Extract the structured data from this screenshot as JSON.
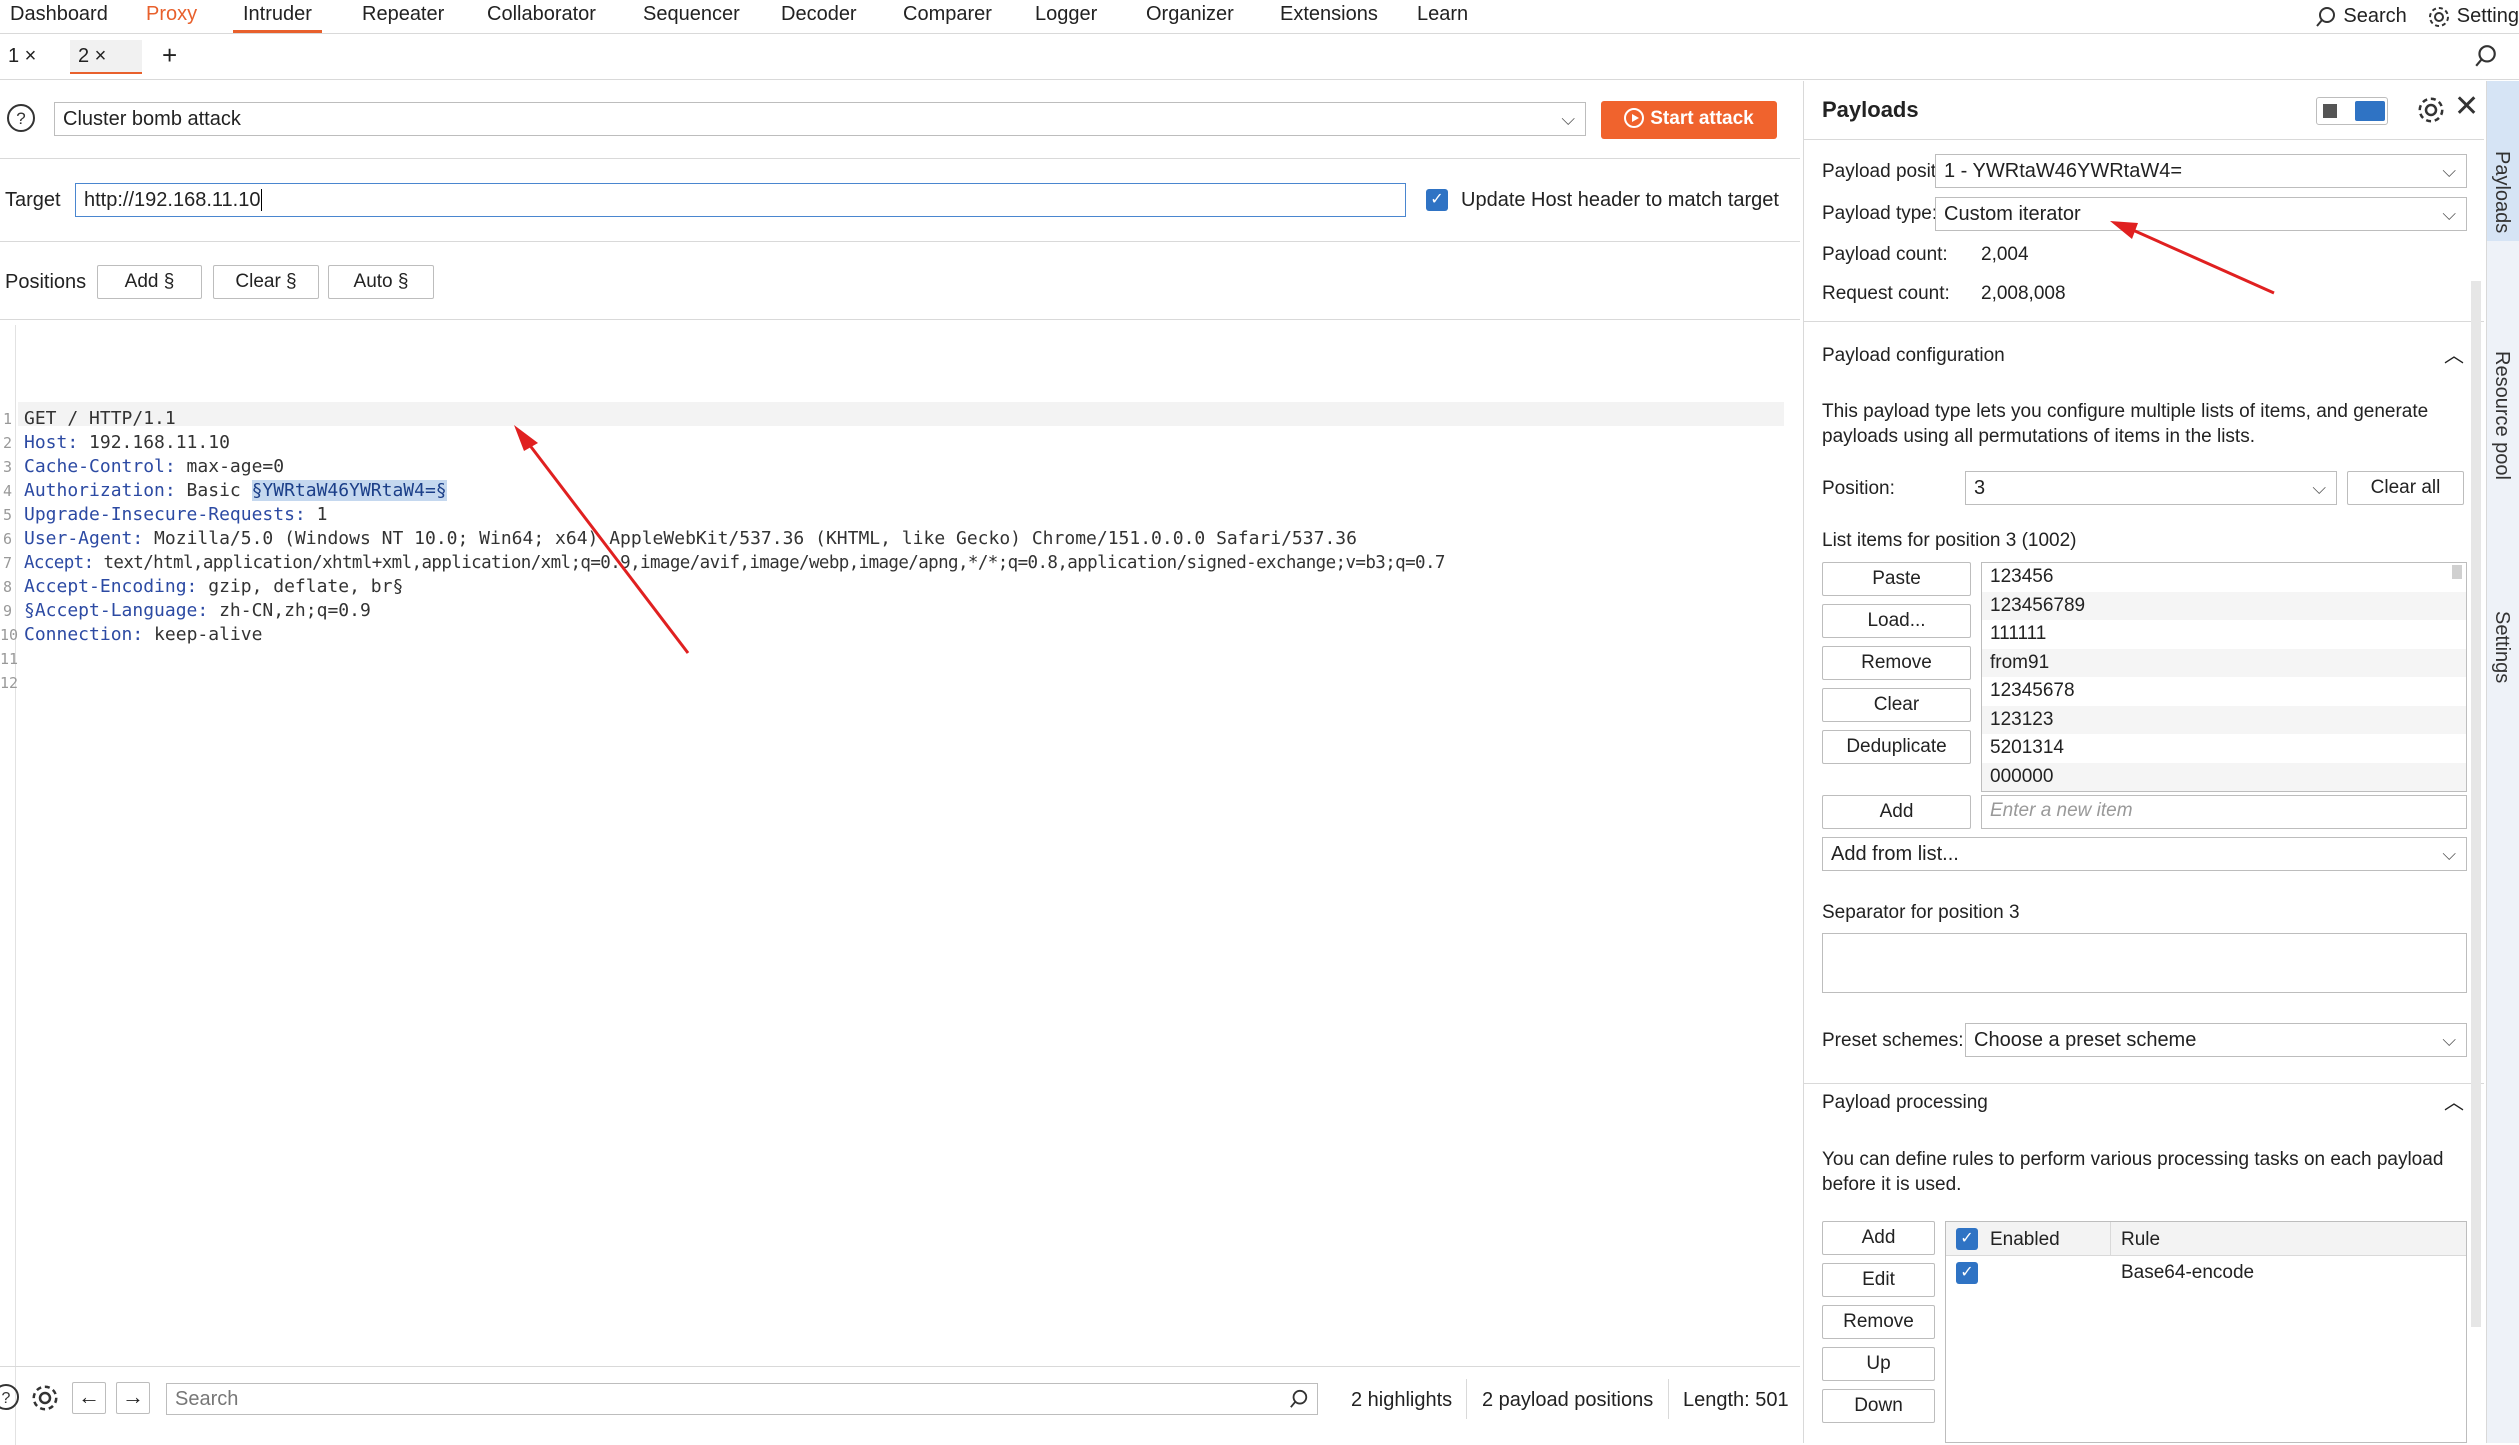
{
  "menubar": {
    "items": [
      "Dashboard",
      "Proxy",
      "Intruder",
      "Repeater",
      "Collaborator",
      "Sequencer",
      "Decoder",
      "Comparer",
      "Logger",
      "Organizer",
      "Extensions",
      "Learn"
    ],
    "search_label": "Search",
    "settings_label": "Setting"
  },
  "tabs": {
    "items": [
      "1 ×",
      "2 ×"
    ],
    "add": "+"
  },
  "attack": {
    "type": "Cluster bomb attack",
    "start_label": "Start attack"
  },
  "target": {
    "label": "Target",
    "value": "http://192.168.11.10",
    "update_host_label": "Update Host header to match target"
  },
  "positions": {
    "label": "Positions",
    "add": "Add §",
    "clear": "Clear §",
    "auto": "Auto §"
  },
  "request": {
    "lines": [
      {
        "num": "1",
        "name": "",
        "value": "GET / HTTP/1.1"
      },
      {
        "num": "2",
        "name": "Host:",
        "value": " 192.168.11.10"
      },
      {
        "num": "3",
        "name": "Cache-Control:",
        "value": " max-age=0"
      },
      {
        "num": "4",
        "name": "Authorization:",
        "value": " Basic ",
        "highlight": "§YWRtaW46YWRtaW4=§"
      },
      {
        "num": "5",
        "name": "Upgrade-Insecure-Requests:",
        "value": " 1"
      },
      {
        "num": "6",
        "name": "User-Agent:",
        "value": " Mozilla/5.0 (Windows NT 10.0; Win64; x64) AppleWebKit/537.36 (KHTML, like Gecko) Chrome/151.0.0.0 Safari/537.36"
      },
      {
        "num": "7",
        "name": "Accept:",
        "value": " text/html,application/xhtml+xml,application/xml;q=0.9,image/avif,image/webp,image/apng,*/*;q=0.8,application/signed-exchange;v=b3;q=0.7"
      },
      {
        "num": "8",
        "name": "Accept-Encoding:",
        "value": " gzip, deflate, br§"
      },
      {
        "num": "9",
        "name": "§Accept-Language:",
        "value": " zh-CN,zh;q=0.9"
      },
      {
        "num": "10",
        "name": "Connection:",
        "value": " keep-alive"
      },
      {
        "num": "11",
        "name": "",
        "value": ""
      },
      {
        "num": "12",
        "name": "",
        "value": ""
      }
    ]
  },
  "footer": {
    "search_placeholder": "Search",
    "highlights": "2 highlights",
    "payload_positions": "2 payload positions",
    "length": "Length: 501"
  },
  "payloads": {
    "title": "Payloads",
    "position_label": "Payload position:",
    "position_value": "1 - YWRtaW46YWRtaW4=",
    "type_label": "Payload type:",
    "type_value": "Custom iterator",
    "count_label": "Payload count:",
    "count_value": "2,004",
    "request_count_label": "Request count:",
    "request_count_value": "2,008,008"
  },
  "config": {
    "title": "Payload configuration",
    "description": "This payload type lets you configure multiple lists of items, and generate payloads using all permutations of items in the lists.",
    "position_label": "Position:",
    "position_value": "3",
    "clear_all": "Clear all",
    "list_title": "List items for position 3 (1002)",
    "buttons": [
      "Paste",
      "Load...",
      "Remove",
      "Clear",
      "Deduplicate"
    ],
    "items": [
      "123456",
      "123456789",
      "111111",
      "from91",
      "12345678",
      "123123",
      "5201314",
      "000000"
    ],
    "add": "Add",
    "new_item_placeholder": "Enter a new item",
    "add_from_list": "Add from list...",
    "separator_label": "Separator for position 3",
    "preset_label": "Preset schemes:",
    "preset_value": "Choose a preset scheme"
  },
  "processing": {
    "title": "Payload processing",
    "description": "You can define rules to perform various processing tasks on each payload before it is used.",
    "buttons": [
      "Add",
      "Edit",
      "Remove",
      "Up",
      "Down"
    ],
    "col_enabled": "Enabled",
    "col_rule": "Rule",
    "rules": [
      {
        "rule": "Base64-encode"
      }
    ]
  },
  "side_tabs": [
    "Payloads",
    "Resource pool",
    "Settings"
  ],
  "colors": {
    "accent": "#e8602c",
    "checkbox": "#2f73c4",
    "annotation_arrow": "#e02020"
  }
}
